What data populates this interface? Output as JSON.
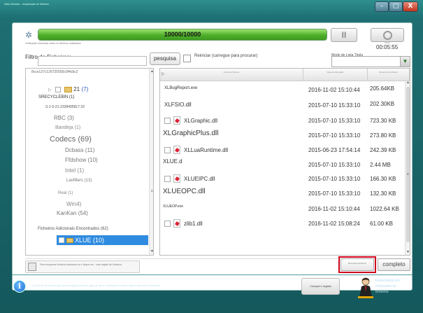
{
  "window": {
    "title": "Data Lifesaver - recuperação de ficheiros",
    "minimize": "–",
    "maximize": "□",
    "close": "X"
  },
  "scan": {
    "progress_text": "10000/10000",
    "progress_fraction": 1.0,
    "sub_status": "verificação concluída, todos os ficheiros analisados",
    "pause_label": "II",
    "stop_caption": "Parar",
    "timer": "00:05:55"
  },
  "filter": {
    "label": "Filtro de Ficheiros:",
    "value": "",
    "search_button": "pesquisa",
    "restart_label": "Reiniciar (carregue para procurar)",
    "mode_label": "Modo de Lista Tripla",
    "mode_value": ""
  },
  "tree": {
    "items": [
      {
        "label": "8cce127c126725555c0f4cbc2",
        "small": true
      },
      {
        "label": "21",
        "count": "(7)"
      },
      {
        "label": "SRECYCLEBIN (1)"
      },
      {
        "label": "S-1-5-21-2338495817-32"
      },
      {
        "label": "RBC (3)"
      },
      {
        "label": "Bandeja (1)"
      },
      {
        "label": "Codecs (69)"
      },
      {
        "label": "Dcbass (11)"
      },
      {
        "label": "Ffdshow (10)"
      },
      {
        "label": "Intel (1)"
      },
      {
        "label": "Lavfilters (13)"
      },
      {
        "label": "Real (1)"
      },
      {
        "label": "Wm4)"
      },
      {
        "label": "KanKan (54)"
      },
      {
        "label": "XLUE (10)"
      }
    ],
    "footer": "Ficheiros Adicionais Encontrados (62)"
  },
  "list": {
    "columns": [
      "Nome do ficheiro",
      "Data de alteração",
      "Tamanho do ficheiro"
    ],
    "rows": [
      {
        "name": "XLBugReport.exe",
        "date": "2016-11-02 15:10:44",
        "size": "205.64KB",
        "icon": false
      },
      {
        "name": "XLFSIO.dll",
        "date": "2015-07-10 15:33:10",
        "size": "202.30KB",
        "icon": false
      },
      {
        "name": "XLGraphic.dll",
        "date": "2015-07-10 15:33:10",
        "size": "723.30 KB",
        "icon": true
      },
      {
        "name": "XLGraphicPlus.dll",
        "date": "2015-07-10 15:33:10",
        "size": "273.80 KB",
        "icon": false
      },
      {
        "name": "XLLuaRuntime.dll",
        "date": "2015-06-23 17:54:14",
        "size": "242.39 KB",
        "icon": true
      },
      {
        "name": "XLUE.d",
        "date": "2015-07-10 15:33:10",
        "size": "2.44 MB",
        "icon": false
      },
      {
        "name": "XLUEIPC.dll",
        "date": "2015-07-10 15:33:10",
        "size": "166.30 KB",
        "icon": true
      },
      {
        "name": "XLUEOPC.dll",
        "date": "2015-07-10 15:33:10",
        "size": "132.30 KB",
        "icon": false
      },
      {
        "name": "XLUEOP.exe",
        "date": "2016-11-02 15:10:44",
        "size": "1022.64 KB",
        "icon": false
      },
      {
        "name": "zlib1.dll",
        "date": "2016-11-02 15:08:24",
        "size": "61.00 KB",
        "icon": true
      }
    ]
  },
  "footer": {
    "status_text": "Para recuperar ficheiros selecione-os e clique em - criar registo de ficheiros",
    "small_button": "Recuperar ficheiros",
    "complete_button": "completo",
    "info_text": "O processo de recuperação demora alguns minutos, aguarde até a verificação terminar e depois selecione os ficheiros.",
    "buy_button": "Compra e registo",
    "expert_text": "Especialista em chamadas de ficheiros"
  }
}
